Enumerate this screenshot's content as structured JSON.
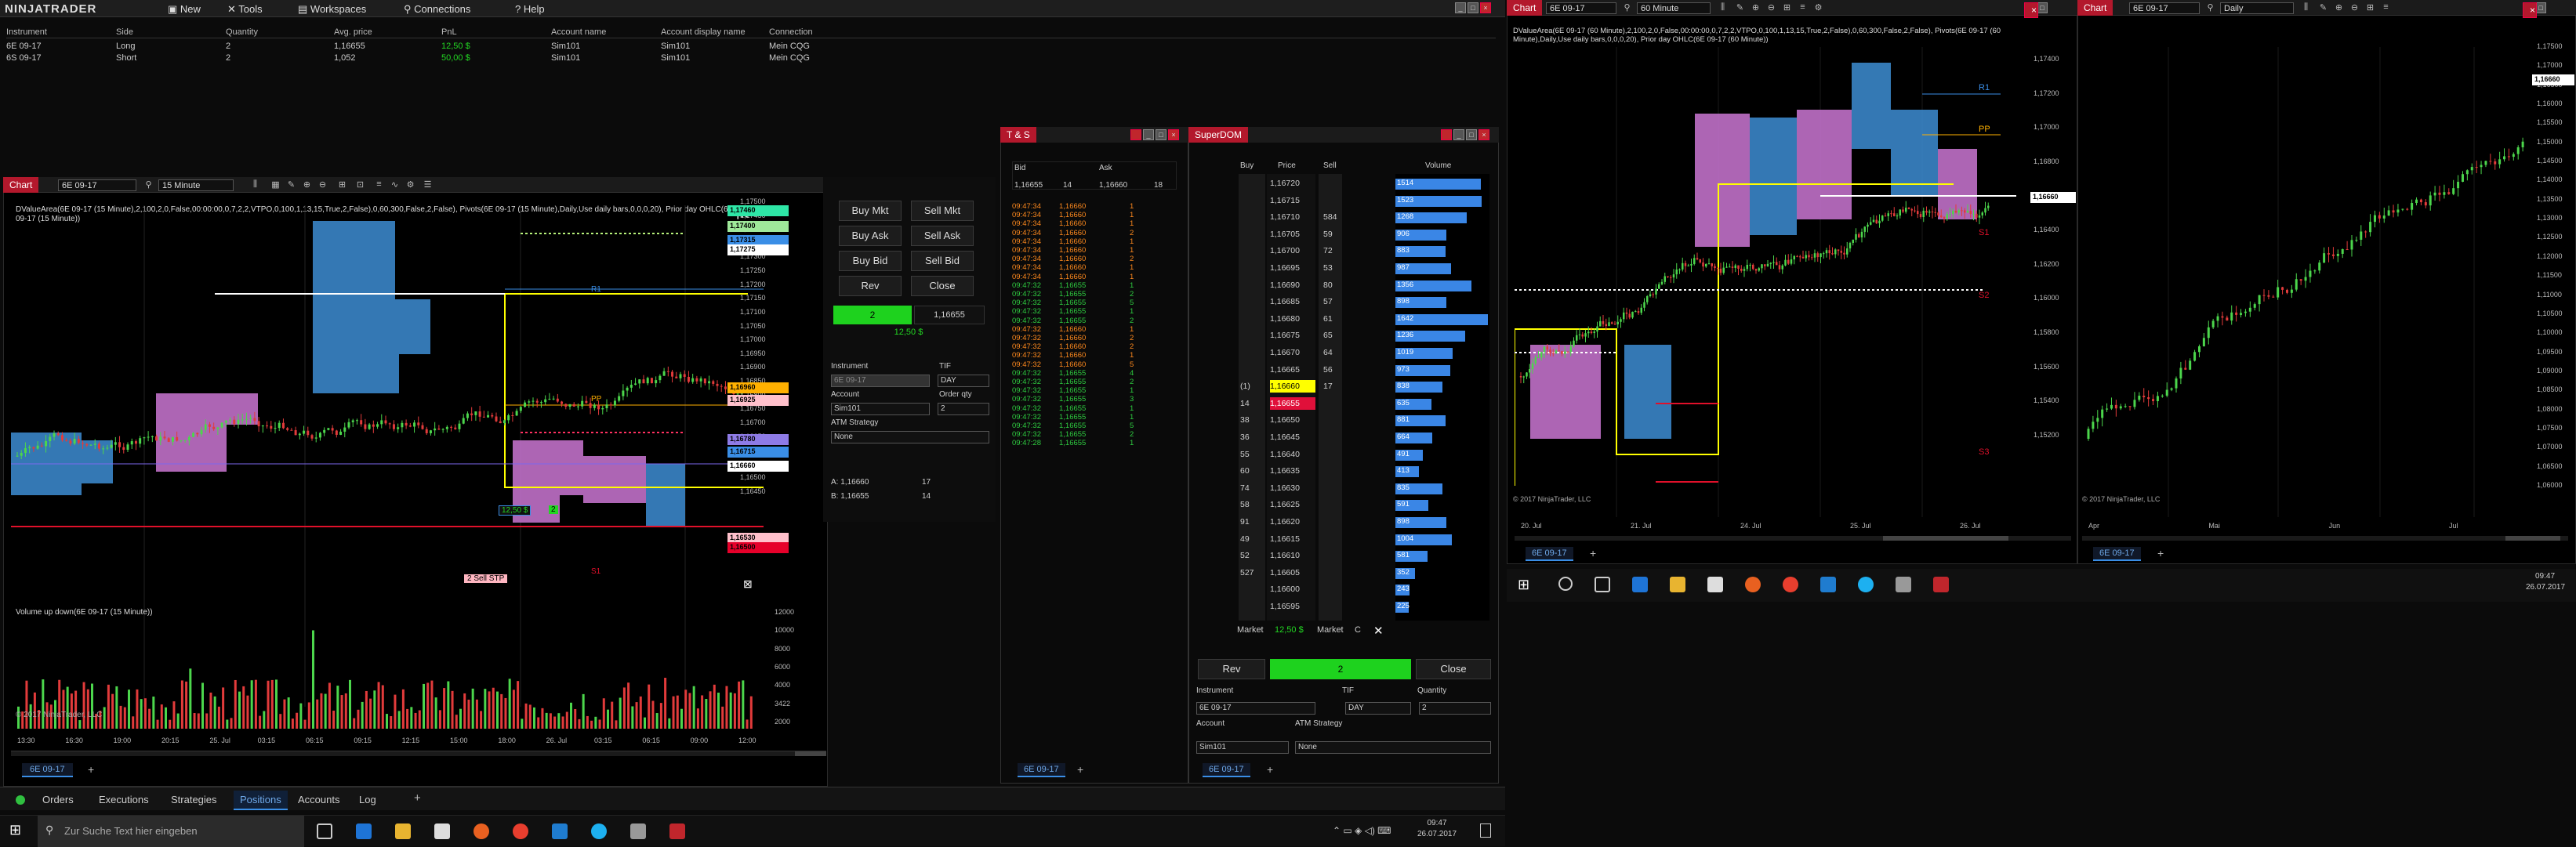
{
  "app": {
    "logo": "NINJATRADER",
    "menu": [
      "New",
      "Tools",
      "Workspaces",
      "Connections",
      "Help"
    ]
  },
  "positions": {
    "columns": [
      "Instrument",
      "Side",
      "Quantity",
      "Avg. price",
      "PnL",
      "Account name",
      "Account display name",
      "Connection"
    ],
    "rows": [
      [
        "6E 09-17",
        "Long",
        "2",
        "1,16655",
        "12,50 $",
        "Sim101",
        "Sim101",
        "Mein CQG"
      ],
      [
        "6S 09-17",
        "Short",
        "2",
        "1,052",
        "50,00 $",
        "Sim101",
        "Sim101",
        "Mein CQG"
      ]
    ]
  },
  "chart1": {
    "tab": "Chart",
    "instrument": "6E 09-17",
    "interval": "15 Minute",
    "indicator_text": "DValueArea(6E 09-17 (15 Minute),2,100,2,0,False,00:00:00,0,7,2,2,VTPO,0,100,1,13,15,True,2,False),0,60,300,False,2,False), Pivots(6E 09-17 (15 Minute),Daily,Use daily bars,0,0,0,20), Prior day OHLC(6E 09-17 (15 Minute))",
    "volume_text": "Volume up down(6E 09-17 (15 Minute))",
    "copyright": "© 2017 NinjaTrader, LLC",
    "price_ticks": [
      "1,17500",
      "1,17450",
      "1,17400",
      "1,17350",
      "1,17300",
      "1,17250",
      "1,17200",
      "1,17150",
      "1,17100",
      "1,17050",
      "1,17000",
      "1,16950",
      "1,16900",
      "1,16850",
      "1,16800",
      "1,16750",
      "1,16700",
      "1,16650",
      "1,16600",
      "1,16550",
      "1,16500",
      "1,16450"
    ],
    "price_labels": [
      {
        "t": "1,17460",
        "c": "#2ee6a6"
      },
      {
        "t": "1,17400",
        "c": "#9fe89a"
      },
      {
        "t": "1,17315",
        "c": "#3a8ee6"
      },
      {
        "t": "1,17275",
        "c": "#ffffff"
      },
      {
        "t": "1,16960",
        "c": "#ffb000"
      },
      {
        "t": "1,16925",
        "c": "#ffc0cb"
      },
      {
        "t": "1,16780",
        "c": "#8e7be6"
      },
      {
        "t": "1,16715",
        "c": "#3a8ee6"
      },
      {
        "t": "1,16660",
        "c": "#ffffff"
      },
      {
        "t": "1,16530",
        "c": "#ffc0cb"
      },
      {
        "t": "1,16500",
        "c": "#e6002a"
      }
    ],
    "pivot_labels": [
      "R1",
      "PP",
      "S1"
    ],
    "vol_ticks": [
      "12000",
      "10000",
      "8000",
      "6000",
      "4000",
      "3422",
      "2000"
    ],
    "time_ticks": [
      "13:30",
      "16:30",
      "19:00",
      "20:15",
      "25. Jul",
      "03:15",
      "06:15",
      "09:15",
      "12:15",
      "15:00",
      "18:00",
      "26. Jul",
      "03:15",
      "06:15",
      "09:00",
      "12:00"
    ],
    "position_label": "12,50 $",
    "order_label": "2  Sell STP",
    "order_qty": "2",
    "bottom_tab": "6E 09-17"
  },
  "chart_trader": {
    "buttons": [
      "Buy Mkt",
      "Sell Mkt",
      "Buy Ask",
      "Sell Ask",
      "Buy Bid",
      "Sell Bid",
      "Rev",
      "Close"
    ],
    "position_qty": "2",
    "position_price": "1,16655",
    "pnl": "12,50 $",
    "instrument_label": "Instrument",
    "instrument": "6E 09-17",
    "tif_label": "TIF",
    "tif": "DAY",
    "account_label": "Account",
    "account": "Sim101",
    "order_qty_label": "Order qty",
    "order_qty": "2",
    "atm_label": "ATM Strategy",
    "atm": "None",
    "ask_line": "A: 1,16660",
    "ask_qty": "17",
    "bid_line": "B: 1,16655",
    "bid_qty": "14"
  },
  "ts": {
    "title": "T & S",
    "col_bid": "Bid",
    "col_ask": "Ask",
    "bid": "1,16655",
    "bid_sz": "14",
    "ask": "1,16660",
    "ask_sz": "18",
    "rows": [
      [
        "09:47:34",
        "1,16660",
        "1",
        "o"
      ],
      [
        "09:47:34",
        "1,16660",
        "1",
        "o"
      ],
      [
        "09:47:34",
        "1,16660",
        "1",
        "o"
      ],
      [
        "09:47:34",
        "1,16660",
        "2",
        "o"
      ],
      [
        "09:47:34",
        "1,16660",
        "1",
        "o"
      ],
      [
        "09:47:34",
        "1,16660",
        "1",
        "o"
      ],
      [
        "09:47:34",
        "1,16660",
        "2",
        "o"
      ],
      [
        "09:47:34",
        "1,16660",
        "1",
        "o"
      ],
      [
        "09:47:34",
        "1,16660",
        "1",
        "o"
      ],
      [
        "09:47:32",
        "1,16655",
        "1",
        "g"
      ],
      [
        "09:47:32",
        "1,16655",
        "2",
        "g"
      ],
      [
        "09:47:32",
        "1,16655",
        "5",
        "g"
      ],
      [
        "09:47:32",
        "1,16655",
        "1",
        "g"
      ],
      [
        "09:47:32",
        "1,16655",
        "2",
        "g"
      ],
      [
        "09:47:32",
        "1,16660",
        "1",
        "o"
      ],
      [
        "09:47:32",
        "1,16660",
        "2",
        "o"
      ],
      [
        "09:47:32",
        "1,16660",
        "2",
        "o"
      ],
      [
        "09:47:32",
        "1,16660",
        "1",
        "o"
      ],
      [
        "09:47:32",
        "1,16660",
        "5",
        "o"
      ],
      [
        "09:47:32",
        "1,16655",
        "4",
        "g"
      ],
      [
        "09:47:32",
        "1,16655",
        "2",
        "g"
      ],
      [
        "09:47:32",
        "1,16655",
        "1",
        "g"
      ],
      [
        "09:47:32",
        "1,16655",
        "3",
        "g"
      ],
      [
        "09:47:32",
        "1,16655",
        "1",
        "g"
      ],
      [
        "09:47:32",
        "1,16655",
        "1",
        "g"
      ],
      [
        "09:47:32",
        "1,16655",
        "5",
        "g"
      ],
      [
        "09:47:32",
        "1,16655",
        "2",
        "g"
      ],
      [
        "09:47:28",
        "1,16655",
        "1",
        "g"
      ]
    ],
    "tab": "6E 09-17"
  },
  "dom": {
    "title": "SuperDOM",
    "col_buy": "Buy",
    "col_price": "Price",
    "col_sell": "Sell",
    "col_vol": "Volume",
    "rows": [
      [
        "",
        "1,16720",
        "",
        "1514",
        0.92
      ],
      [
        "",
        "1,16715",
        "",
        "1523",
        0.93
      ],
      [
        "",
        "1,16710",
        "584",
        "1268",
        0.77
      ],
      [
        "",
        "1,16705",
        "59",
        "906",
        0.55
      ],
      [
        "",
        "1,16700",
        "72",
        "883",
        0.54
      ],
      [
        "",
        "1,16695",
        "53",
        "987",
        0.6
      ],
      [
        "",
        "1,16690",
        "80",
        "1356",
        0.82
      ],
      [
        "",
        "1,16685",
        "57",
        "898",
        0.55
      ],
      [
        "",
        "1,16680",
        "61",
        "1642",
        1.0
      ],
      [
        "",
        "1,16675",
        "65",
        "1236",
        0.75
      ],
      [
        "",
        "1,16670",
        "64",
        "1019",
        0.62
      ],
      [
        "",
        "1,16665",
        "56",
        "973",
        0.59
      ],
      [
        "(1)",
        "1,16660",
        "17",
        "838",
        0.51
      ],
      [
        "14",
        "1,16655",
        "",
        "635",
        0.39
      ],
      [
        "38",
        "1,16650",
        "",
        "881",
        0.54
      ],
      [
        "36",
        "1,16645",
        "",
        "664",
        0.4
      ],
      [
        "55",
        "1,16640",
        "",
        "491",
        0.3
      ],
      [
        "60",
        "1,16635",
        "",
        "413",
        0.25
      ],
      [
        "74",
        "1,16630",
        "",
        "835",
        0.51
      ],
      [
        "58",
        "1,16625",
        "",
        "591",
        0.36
      ],
      [
        "91",
        "1,16620",
        "",
        "898",
        0.55
      ],
      [
        "49",
        "1,16615",
        "",
        "1004",
        0.61
      ],
      [
        "52",
        "1,16610",
        "",
        "581",
        0.35
      ],
      [
        "527",
        "1,16605",
        "",
        "352",
        0.21
      ],
      [
        "",
        "1,16600",
        "",
        "243",
        0.15
      ],
      [
        "",
        "1,16595",
        "",
        "225",
        0.14
      ]
    ],
    "market_l": "Market",
    "pnl": "12,50 $",
    "market_r": "Market",
    "c": "C",
    "rev": "Rev",
    "qty": "2",
    "close": "Close",
    "instrument_label": "Instrument",
    "instrument": "6E 09-17",
    "tif_label": "TIF",
    "tif": "DAY",
    "qty_label": "Quantity",
    "qty_val": "2",
    "account_label": "Account",
    "account": "Sim101",
    "atm_label": "ATM Strategy",
    "atm": "None",
    "tab": "6E 09-17"
  },
  "bottom_tabs": [
    "Orders",
    "Executions",
    "Strategies",
    "Positions",
    "Accounts",
    "Log"
  ],
  "taskbar": {
    "search": "Zur Suche Text hier eingeben",
    "time": "09:47",
    "date": "26.07.2017"
  },
  "chart2": {
    "tab": "Chart",
    "instrument": "6E 09-17",
    "interval": "60 Minute",
    "indicator_text": "DValueArea(6E 09-17 (60 Minute),2,100,2,0,False,00:00:00,0,7,2,2,VTPO,0,100,1,13,15,True,2,False),0,60,300,False,2,False), Pivots(6E 09-17 (60 Minute),Daily,Use daily bars,0,0,0,20), Prior day OHLC(6E 09-17 (60 Minute))",
    "price_ticks": [
      "1,17400",
      "1,17200",
      "1,17000",
      "1,16800",
      "1,16600",
      "1,16400",
      "1,16200",
      "1,16000",
      "1,15800",
      "1,15600",
      "1,15400",
      "1,15200"
    ],
    "current": "1,16660",
    "time_ticks": [
      "20. Jul",
      "21. Jul",
      "24. Jul",
      "25. Jul",
      "26. Jul"
    ],
    "copyright": "© 2017 NinjaTrader, LLC",
    "pivots": [
      "R1",
      "PP",
      "S1",
      "S2",
      "S3"
    ],
    "bottom_tab": "6E 09-17"
  },
  "chart3": {
    "tab": "Chart",
    "instrument": "6E 09-17",
    "interval": "Daily",
    "price_ticks": [
      "1,17500",
      "1,17000",
      "1,16500",
      "1,16000",
      "1,15500",
      "1,15000",
      "1,14500",
      "1,14000",
      "1,13500",
      "1,13000",
      "1,12500",
      "1,12000",
      "1,11500",
      "1,11000",
      "1,10500",
      "1,10000",
      "1,09500",
      "1,09000",
      "1,08500",
      "1,08000",
      "1,07500",
      "1,07000",
      "1,06500",
      "1,06000"
    ],
    "current": "1,16660",
    "time_ticks": [
      "Apr",
      "Mai",
      "Jun",
      "Jul"
    ],
    "copyright": "© 2017 NinjaTrader, LLC",
    "bottom_tab": "6E 09-17"
  },
  "taskbar2": {
    "time": "09:47",
    "date": "26.07.2017"
  }
}
